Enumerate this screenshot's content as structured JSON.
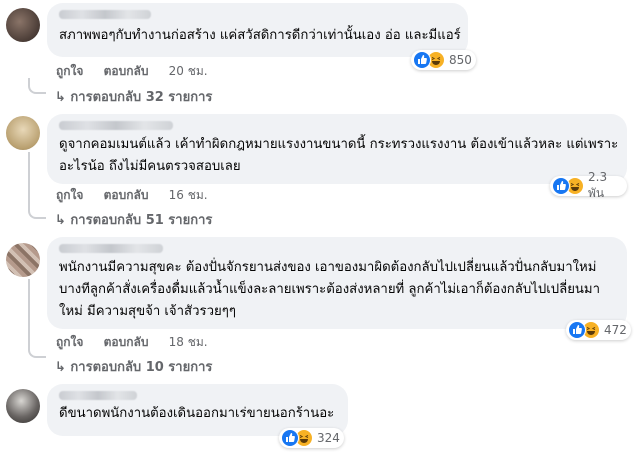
{
  "comments": [
    {
      "text_lines": [
        "สภาพพอๆกับทำงานก่อสร้าง แค่สวัสดิการดีกว่าเท่านั้นเอง อ่อ และมีแอร์"
      ],
      "reactions": "850",
      "like_label": "ถูกใจ",
      "reply_label": "ตอบกลับ",
      "time": "20 ชม.",
      "replies_label": "การตอบกลับ 32 รายการ"
    },
    {
      "text_lines": [
        "ดูจากคอมเมนต์แล้ว เค้าทำผิดกฎหมายแรงงานขนาดนี้ กระทรวงแรงงาน ต้องเข้าแล้วหละ แต่เพราะ",
        "อะไรน้อ ถึงไม่มีคนตรวจสอบเลย"
      ],
      "reactions": "2.3 พัน",
      "like_label": "ถูกใจ",
      "reply_label": "ตอบกลับ",
      "time": "16 ชม.",
      "replies_label": "การตอบกลับ 51 รายการ"
    },
    {
      "text_lines": [
        "พนักงานมีความสุขคะ ต้องปั่นจักรยานส่งของ เอาของมาผิดต้องกลับไปเปลี่ยนแล้วปั่นกลับมาใหม่",
        "บางทีลูกค้าสั่งเครื่องดื่มแล้วน้ำแข็งละลายเพราะต้องส่งหลายที่ ลูกค้าไม่เอาก็ต้องกลับไปเปลี่ยนมา",
        "ใหม่ มีความสุขจ้า เจ้าสัวรวยๆๆ"
      ],
      "reactions": "472",
      "like_label": "ถูกใจ",
      "reply_label": "ตอบกลับ",
      "time": "18 ชม.",
      "replies_label": "การตอบกลับ 10 รายการ"
    },
    {
      "text_lines": [
        "ดีขนาดพนักงานต้องเดินออกมาเร่ขายนอกร้านอะ"
      ],
      "reactions": "324"
    }
  ],
  "colors": {
    "bubble": "#f0f2f5",
    "meta_text": "#65676b",
    "like_blue": "#1877f2",
    "haha_yellow": "#f7b125"
  },
  "icons": [
    "like-icon",
    "haha-icon",
    "reply-arrow-icon"
  ]
}
